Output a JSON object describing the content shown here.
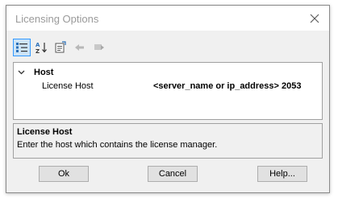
{
  "window": {
    "title": "Licensing Options",
    "close_icon": "close-icon"
  },
  "toolbar": {
    "buttons": [
      {
        "icon": "categorized-view-icon",
        "active": true
      },
      {
        "icon": "sort-alphabetical-icon",
        "active": false
      },
      {
        "icon": "property-pages-icon",
        "active": false
      },
      {
        "icon": "back-arrow-icon",
        "active": false
      },
      {
        "icon": "forward-arrow-icon",
        "active": false
      }
    ]
  },
  "grid": {
    "category": "Host",
    "properties": [
      {
        "name": "License Host",
        "value": "<server_name or ip_address> 2053"
      }
    ]
  },
  "help": {
    "title": "License Host",
    "description": "Enter the host which contains the license manager."
  },
  "buttons": {
    "ok": "Ok",
    "cancel": "Cancel",
    "help": "Help..."
  }
}
